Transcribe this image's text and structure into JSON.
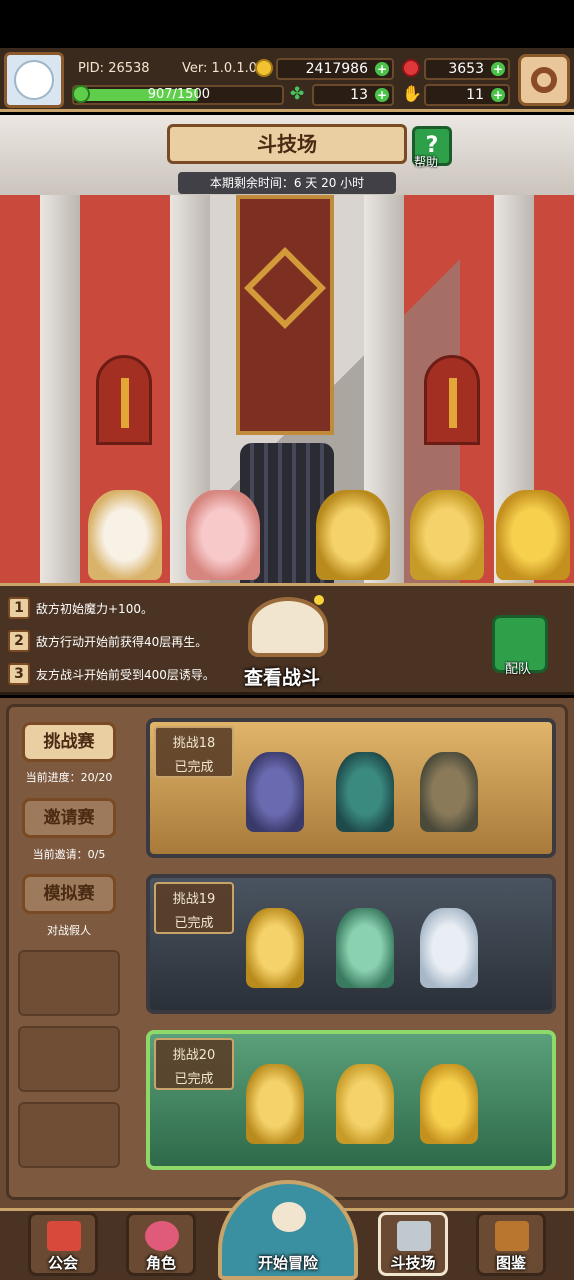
{
  "header": {
    "pid": "PID: 26538",
    "version": "Ver: 1.0.1.0",
    "gold": "2417986",
    "gems": "3653",
    "xp": "907/1500",
    "xp_fraction": 0.6,
    "clover": "13",
    "hand": "11"
  },
  "arena": {
    "title": "斗技场",
    "help_label": "帮助",
    "timer": "本期剩余时间：6 天 20 小时"
  },
  "modifiers": [
    {
      "num": "1",
      "text": "敌方初始魔力+100。"
    },
    {
      "num": "2",
      "text": "敌方行动开始前获得40层再生。"
    },
    {
      "num": "3",
      "text": "友方战斗开始前受到400层诱导。"
    }
  ],
  "view_battle_label": "查看战斗",
  "team_label": "配队",
  "side": {
    "challenge_label": "挑战赛",
    "challenge_progress": "当前进度：20/20",
    "invite_label": "邀请赛",
    "invite_progress": "当前邀请：0/5",
    "sim_label": "模拟赛",
    "sim_sub": "对战假人"
  },
  "challenges": [
    {
      "title": "挑战18",
      "status": "已完成"
    },
    {
      "title": "挑战19",
      "status": "已完成"
    },
    {
      "title": "挑战20",
      "status": "已完成"
    }
  ],
  "nav": {
    "guild": "公会",
    "character": "角色",
    "adventure": "开始冒险",
    "arena": "斗技场",
    "codex": "图鉴"
  },
  "colors": {
    "gold": "#f1c232",
    "gem": "#e0383a",
    "green": "#2fa04a",
    "panel_brown": "#7d5a3f",
    "active_border": "#8fd86a"
  }
}
